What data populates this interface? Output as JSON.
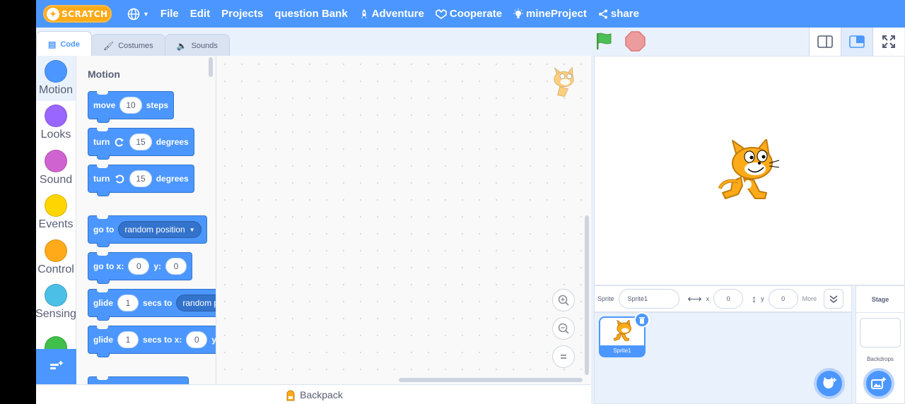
{
  "menu": {
    "logo_text": "SCRATCH",
    "globe_icon": "globe-icon",
    "file": "File",
    "edit": "Edit",
    "projects": "Projects",
    "question_bank": "question Bank",
    "adventure": "Adventure",
    "cooperate": "Cooperate",
    "mine_project": "mineProject",
    "share": "share"
  },
  "tabs": {
    "code": "Code",
    "costumes": "Costumes",
    "sounds": "Sounds"
  },
  "categories": [
    {
      "label": "Motion",
      "color": "#4c97ff"
    },
    {
      "label": "Looks",
      "color": "#9966ff"
    },
    {
      "label": "Sound",
      "color": "#cf63cf"
    },
    {
      "label": "Events",
      "color": "#ffd500"
    },
    {
      "label": "Control",
      "color": "#ffab19"
    },
    {
      "label": "Sensing",
      "color": "#4cbfe6"
    },
    {
      "label": "",
      "color": "#40bf4a"
    }
  ],
  "flyout": {
    "title": "Motion",
    "move": {
      "label": "move",
      "value": "10",
      "suffix": "steps"
    },
    "turn_right": {
      "label": "turn",
      "value": "15",
      "suffix": "degrees"
    },
    "turn_left": {
      "label": "turn",
      "value": "15",
      "suffix": "degrees"
    },
    "goto": {
      "label": "go to",
      "option": "random position"
    },
    "goto_xy": {
      "label": "go to x:",
      "x": "0",
      "ylabel": "y:",
      "y": "0"
    },
    "glide": {
      "label": "glide",
      "value": "1",
      "mid": "secs to",
      "option": "random p"
    },
    "glide_xy": {
      "label": "glide",
      "value": "1",
      "mid": "secs to x:",
      "x": "0",
      "ylabel": "y:"
    }
  },
  "backpack": "Backpack",
  "sprite_info": {
    "sprite_label": "Sprite",
    "sprite_name": "Sprite1",
    "x_label": "x",
    "x_value": "0",
    "y_label": "y",
    "y_value": "0",
    "more": "More"
  },
  "sprite_list": [
    {
      "name": "Sprite1"
    }
  ],
  "stage_panel": {
    "title": "Stage",
    "backdrops": "Backdrops"
  },
  "colors": {
    "accent": "#4c97ff",
    "flag": "#4cbf56",
    "stop": "#ec9c9c"
  }
}
